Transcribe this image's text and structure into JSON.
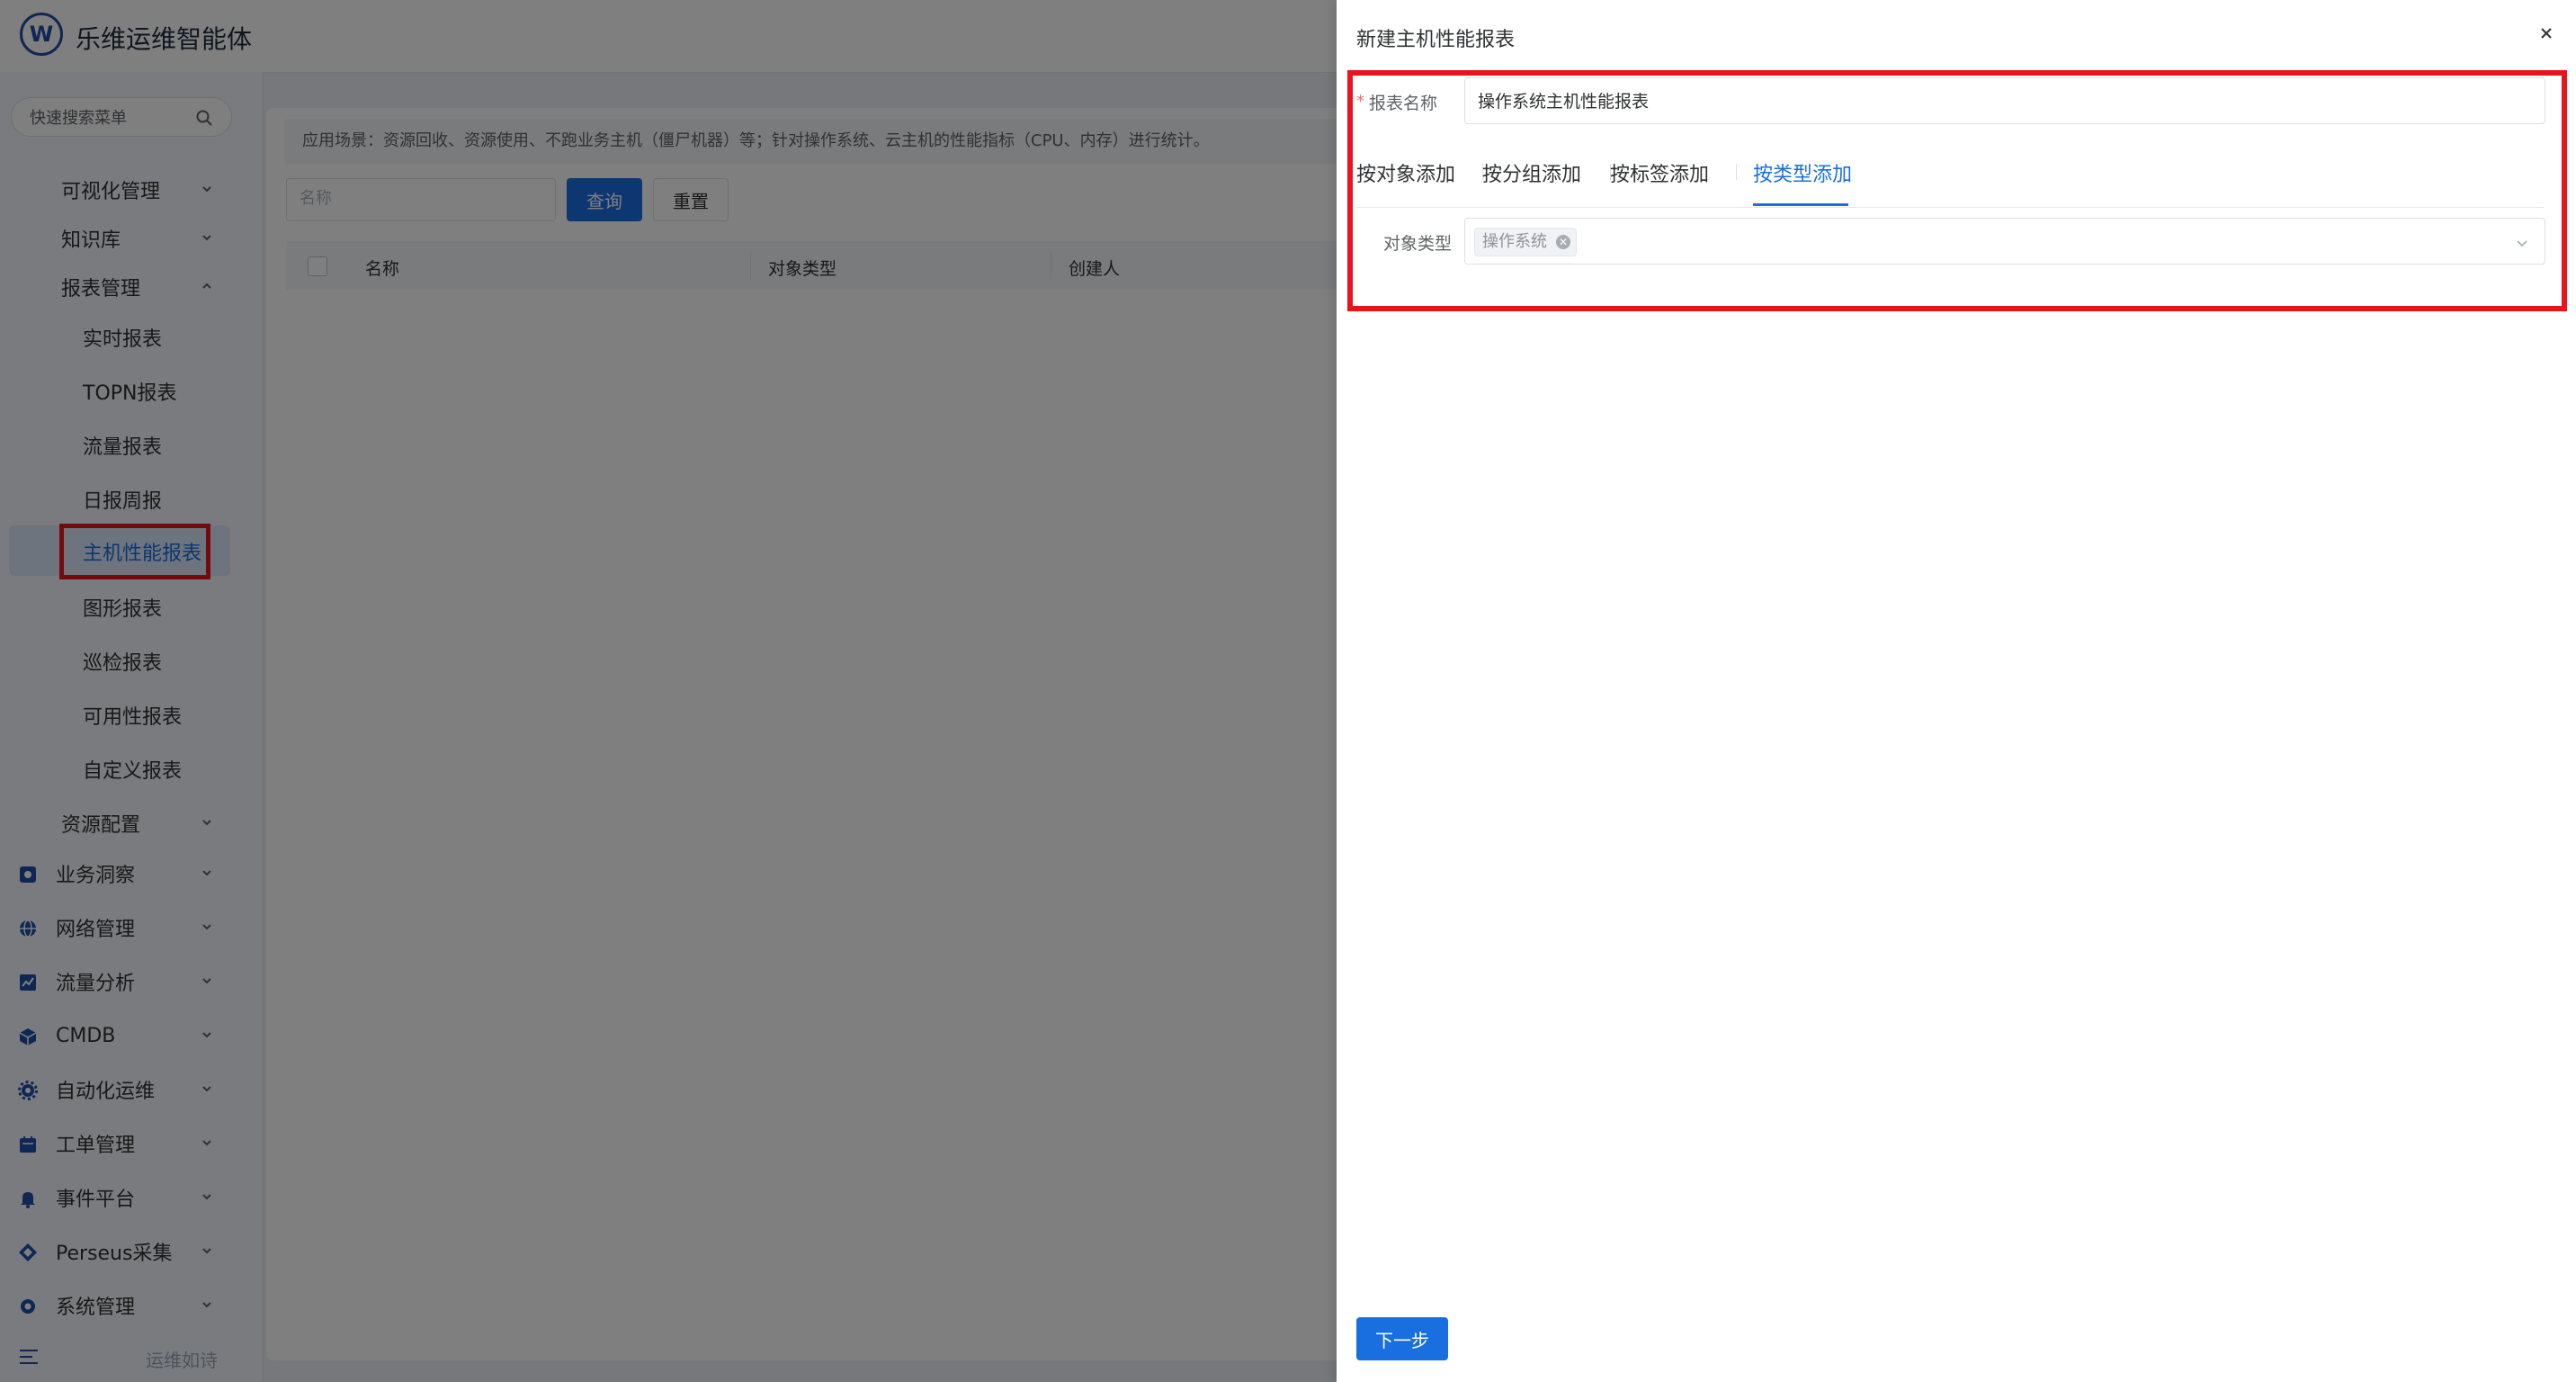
{
  "app": {
    "title": "乐维运维智能体",
    "logo_text": "W"
  },
  "sidebar": {
    "search_placeholder": "快速搜索菜单",
    "groups": [
      {
        "label": "可视化管理"
      },
      {
        "label": "知识库"
      },
      {
        "label": "报表管理"
      }
    ],
    "report_items": [
      {
        "label": "实时报表"
      },
      {
        "label": "TOPN报表"
      },
      {
        "label": "流量报表"
      },
      {
        "label": "日报周报"
      },
      {
        "label": "主机性能报表"
      },
      {
        "label": "图形报表"
      },
      {
        "label": "巡检报表"
      },
      {
        "label": "可用性报表"
      },
      {
        "label": "自定义报表"
      }
    ],
    "resource_config": "资源配置",
    "modules": [
      {
        "label": "业务洞察"
      },
      {
        "label": "网络管理"
      },
      {
        "label": "流量分析"
      },
      {
        "label": "CMDB"
      },
      {
        "label": "自动化运维"
      },
      {
        "label": "工单管理"
      },
      {
        "label": "事件平台"
      },
      {
        "label": "Perseus采集"
      },
      {
        "label": "系统管理"
      }
    ],
    "footer_text": "运维如诗",
    "active_item": "主机性能报表"
  },
  "main": {
    "tip": "应用场景：资源回收、资源使用、不跑业务主机（僵尸机器）等；针对操作系统、云主机的性能指标（CPU、内存）进行统计。",
    "name_placeholder": "名称",
    "query_label": "查询",
    "reset_label": "重置",
    "columns": [
      "名称",
      "对象类型",
      "创建人"
    ]
  },
  "drawer": {
    "title": "新建主机性能报表",
    "required_mark": "*",
    "name_label": "报表名称",
    "name_value": "操作系统主机性能报表",
    "tabs": [
      {
        "label": "按对象添加"
      },
      {
        "label": "按分组添加"
      },
      {
        "label": "按标签添加"
      },
      {
        "label": "按类型添加"
      }
    ],
    "active_tab": "按类型添加",
    "type_label": "对象类型",
    "selected_types": [
      "操作系统"
    ],
    "next_label": "下一步"
  },
  "colors": {
    "primary": "#1a6fe0",
    "highlight": "#e8141c",
    "mask": "rgba(0,0,0,0.5)"
  },
  "icons": [
    "search-icon",
    "chevron-down-icon",
    "chevron-up-icon",
    "close-icon",
    "tag-close-icon",
    "menu-fold-icon"
  ]
}
